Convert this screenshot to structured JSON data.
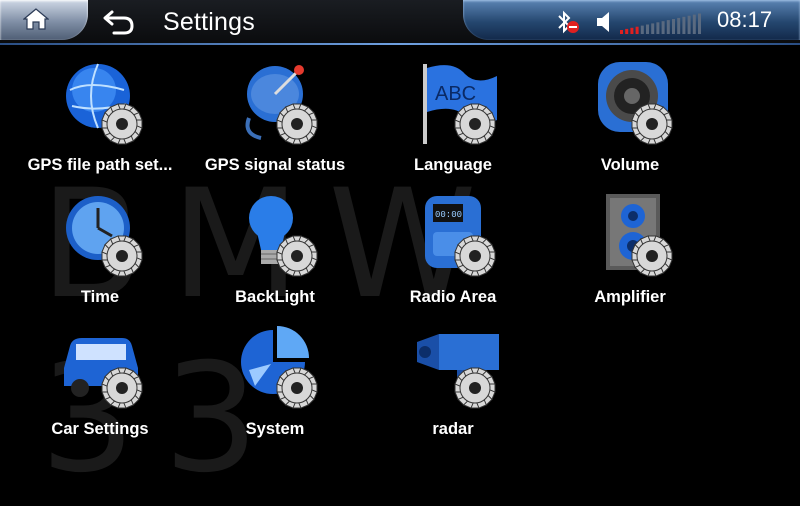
{
  "header": {
    "title": "Settings",
    "clock": "08:17",
    "volume_level": 0.2
  },
  "watermark": "BMW 33",
  "icons": {
    "home": "home-icon",
    "back": "back-arrow-icon",
    "bluetooth": "bluetooth-disconnected-icon",
    "volume": "speaker-icon"
  },
  "colors": {
    "accent": "#3a8ff0",
    "gear": "#d8d8d8",
    "status_bar": "#25476f",
    "bluetooth_off": "#e02020"
  },
  "items": [
    {
      "label": "GPS file path set...",
      "icon": "globe-gear-icon"
    },
    {
      "label": "GPS signal status",
      "icon": "satellite-gear-icon"
    },
    {
      "label": "Language",
      "icon": "abc-flag-gear-icon"
    },
    {
      "label": "Volume",
      "icon": "speaker-gear-icon"
    },
    {
      "label": "Time",
      "icon": "clock-gear-icon"
    },
    {
      "label": "BackLight",
      "icon": "lightbulb-gear-icon"
    },
    {
      "label": "Radio Area",
      "icon": "radio-gear-icon"
    },
    {
      "label": "Amplifier",
      "icon": "amplifier-gear-icon"
    },
    {
      "label": "Car Settings",
      "icon": "car-gear-icon"
    },
    {
      "label": "System",
      "icon": "pie-chart-gear-icon"
    },
    {
      "label": "radar",
      "icon": "radar-camera-gear-icon"
    }
  ]
}
